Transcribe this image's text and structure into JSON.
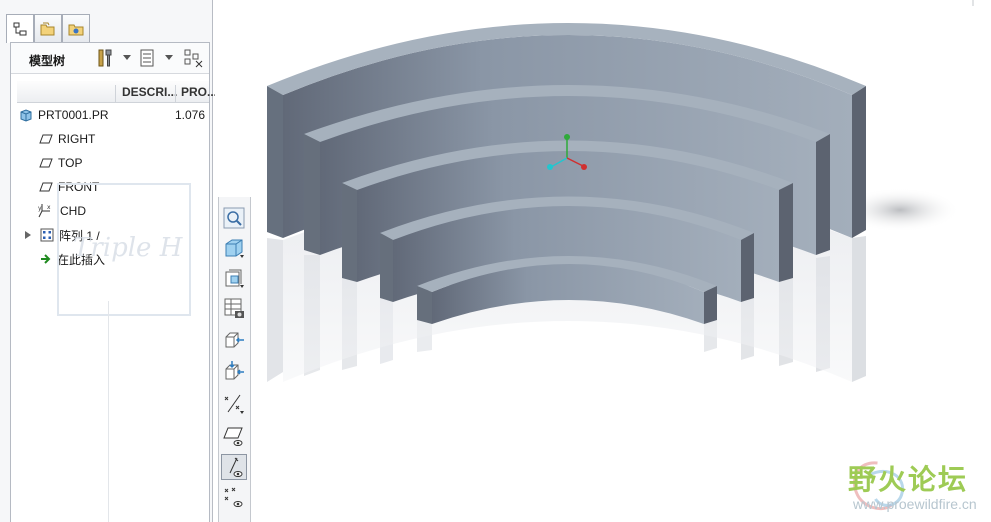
{
  "navigator": {
    "tabs": [
      {
        "name": "model-tree-tab",
        "icon": "model-tree-icon"
      },
      {
        "name": "folder-browser-tab",
        "icon": "folder-icon"
      },
      {
        "name": "favorites-tab",
        "icon": "favorites-icon"
      }
    ],
    "title": "模型树",
    "columns": {
      "description": "DESCRI...",
      "property": "PRO..."
    },
    "rows": [
      {
        "label": "PRT0001.PR",
        "value": "1.076",
        "icon": "part-icon"
      },
      {
        "label": "RIGHT",
        "icon": "datum-plane-icon"
      },
      {
        "label": "TOP",
        "icon": "datum-plane-icon"
      },
      {
        "label": "FRONT",
        "icon": "datum-plane-icon"
      },
      {
        "label": "CHD",
        "icon": "coordinate-system-icon"
      },
      {
        "label": "阵列 1 /",
        "icon": "pattern-icon"
      },
      {
        "label": "在此插入",
        "icon": "insert-here-arrow-icon"
      }
    ],
    "watermark": "Triple H"
  },
  "view_toolbar": [
    {
      "name": "refit-zoom-button",
      "icon": "zoom-icon"
    },
    {
      "name": "display-style-button",
      "icon": "shaded-cube-icon"
    },
    {
      "name": "saved-views-button",
      "icon": "saved-view-icon"
    },
    {
      "name": "view-manager-button",
      "icon": "view-manager-icon"
    },
    {
      "name": "spin-center-button",
      "icon": "spin-center-icon"
    },
    {
      "name": "orient-mode-button",
      "icon": "orient-icon"
    },
    {
      "name": "datum-display-button",
      "icon": "datum-filter-icon"
    },
    {
      "name": "plane-display-button",
      "icon": "plane-display-icon"
    },
    {
      "name": "axis-display-button",
      "icon": "axis-display-icon"
    },
    {
      "name": "point-display-button",
      "icon": "point-display-icon"
    }
  ],
  "forum": {
    "name_cn": "野火论坛",
    "url": "www.proewildfire.cn"
  },
  "colors": {
    "part": "#8e9bab",
    "part_dark": "#5c6370",
    "part_top": "#a6b1bd",
    "accent": "#9ecb55"
  }
}
